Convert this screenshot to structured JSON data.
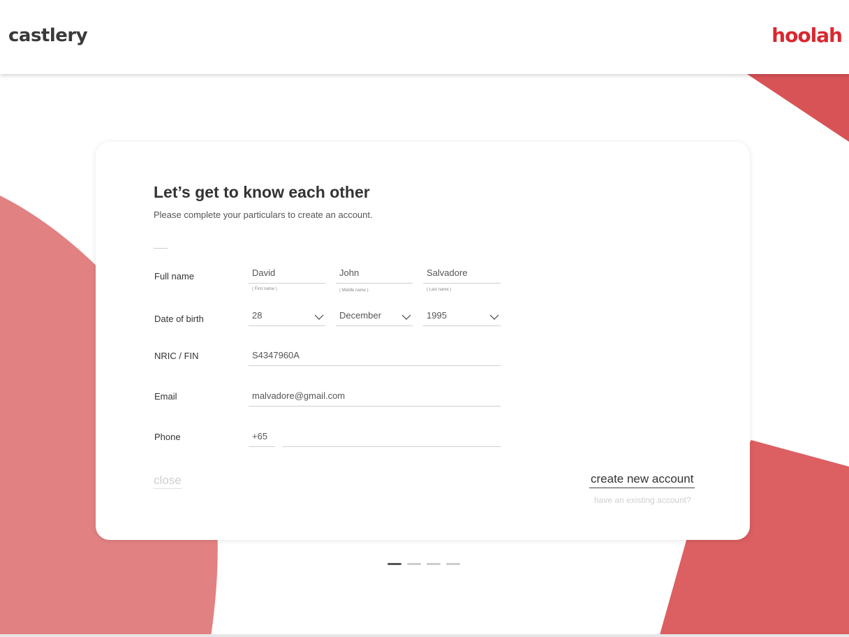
{
  "header": {
    "brand_left": "castlery",
    "brand_right": "hoolah"
  },
  "form": {
    "title": "Let’s get to know each other",
    "subtitle": "Please complete your particulars to create an account.",
    "full_name": {
      "label": "Full name",
      "first": {
        "value": "David",
        "hint": "( First name )"
      },
      "middle": {
        "value": "John",
        "hint": "( Middle name )"
      },
      "last": {
        "value": "Salvadore",
        "hint": "( Last name )"
      }
    },
    "dob": {
      "label": "Date of birth",
      "day": "28",
      "month": "December",
      "year": "1995"
    },
    "nric": {
      "label": "NRIC / FIN",
      "value": "S4347960A"
    },
    "email": {
      "label": "Email",
      "value": "malvadore@gmail.com"
    },
    "phone": {
      "label": "Phone",
      "country_code": "+65",
      "number": ""
    },
    "actions": {
      "close": "close",
      "create": "create new account",
      "existing": "have an existing account?"
    }
  },
  "pager": {
    "total_steps": 4,
    "current_step": 1
  },
  "colors": {
    "accent_red": "#d9282f",
    "shape_red": "#dc5b5f",
    "shape_pink": "#e28182"
  },
  "icons": [
    "chevron-down-icon"
  ]
}
